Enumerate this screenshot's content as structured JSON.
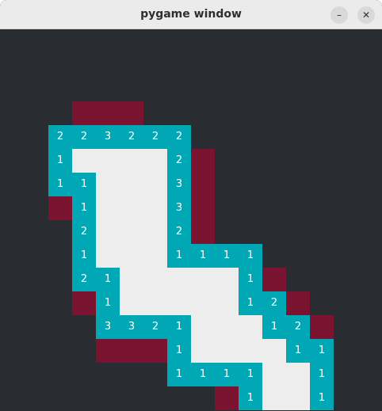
{
  "window": {
    "title": "pygame window",
    "minimize_symbol": "–",
    "close_symbol": "✕"
  },
  "colors": {
    "background": "#292c31",
    "open": "#ededed",
    "number": "#00a8b5",
    "flag": "#7a1330",
    "digit": "#ffffff"
  },
  "cells": [
    {
      "c": 3,
      "r": 3,
      "t": "flag"
    },
    {
      "c": 4,
      "r": 3,
      "t": "flag"
    },
    {
      "c": 5,
      "r": 3,
      "t": "flag"
    },
    {
      "c": 2,
      "r": 4,
      "t": "num",
      "v": "2"
    },
    {
      "c": 3,
      "r": 4,
      "t": "num",
      "v": "2"
    },
    {
      "c": 4,
      "r": 4,
      "t": "num",
      "v": "3"
    },
    {
      "c": 5,
      "r": 4,
      "t": "num",
      "v": "2"
    },
    {
      "c": 6,
      "r": 4,
      "t": "num",
      "v": "2"
    },
    {
      "c": 7,
      "r": 4,
      "t": "num",
      "v": "2"
    },
    {
      "c": 2,
      "r": 5,
      "t": "num",
      "v": "1"
    },
    {
      "c": 3,
      "r": 5,
      "t": "open"
    },
    {
      "c": 4,
      "r": 5,
      "t": "open"
    },
    {
      "c": 5,
      "r": 5,
      "t": "open"
    },
    {
      "c": 6,
      "r": 5,
      "t": "open"
    },
    {
      "c": 7,
      "r": 5,
      "t": "num",
      "v": "2"
    },
    {
      "c": 8,
      "r": 5,
      "t": "flag"
    },
    {
      "c": 2,
      "r": 6,
      "t": "num",
      "v": "1"
    },
    {
      "c": 3,
      "r": 6,
      "t": "num",
      "v": "1"
    },
    {
      "c": 4,
      "r": 6,
      "t": "open"
    },
    {
      "c": 5,
      "r": 6,
      "t": "open"
    },
    {
      "c": 6,
      "r": 6,
      "t": "open"
    },
    {
      "c": 7,
      "r": 6,
      "t": "num",
      "v": "3"
    },
    {
      "c": 8,
      "r": 6,
      "t": "flag"
    },
    {
      "c": 2,
      "r": 7,
      "t": "flag"
    },
    {
      "c": 3,
      "r": 7,
      "t": "num",
      "v": "1"
    },
    {
      "c": 4,
      "r": 7,
      "t": "open"
    },
    {
      "c": 5,
      "r": 7,
      "t": "open"
    },
    {
      "c": 6,
      "r": 7,
      "t": "open"
    },
    {
      "c": 7,
      "r": 7,
      "t": "num",
      "v": "3"
    },
    {
      "c": 8,
      "r": 7,
      "t": "flag"
    },
    {
      "c": 3,
      "r": 8,
      "t": "num",
      "v": "2"
    },
    {
      "c": 4,
      "r": 8,
      "t": "open"
    },
    {
      "c": 5,
      "r": 8,
      "t": "open"
    },
    {
      "c": 6,
      "r": 8,
      "t": "open"
    },
    {
      "c": 7,
      "r": 8,
      "t": "num",
      "v": "2"
    },
    {
      "c": 8,
      "r": 8,
      "t": "flag"
    },
    {
      "c": 3,
      "r": 9,
      "t": "num",
      "v": "1"
    },
    {
      "c": 4,
      "r": 9,
      "t": "open"
    },
    {
      "c": 5,
      "r": 9,
      "t": "open"
    },
    {
      "c": 6,
      "r": 9,
      "t": "open"
    },
    {
      "c": 7,
      "r": 9,
      "t": "num",
      "v": "1"
    },
    {
      "c": 8,
      "r": 9,
      "t": "num",
      "v": "1"
    },
    {
      "c": 9,
      "r": 9,
      "t": "num",
      "v": "1"
    },
    {
      "c": 10,
      "r": 9,
      "t": "num",
      "v": "1"
    },
    {
      "c": 3,
      "r": 10,
      "t": "num",
      "v": "2"
    },
    {
      "c": 4,
      "r": 10,
      "t": "num",
      "v": "1"
    },
    {
      "c": 5,
      "r": 10,
      "t": "open"
    },
    {
      "c": 6,
      "r": 10,
      "t": "open"
    },
    {
      "c": 7,
      "r": 10,
      "t": "open"
    },
    {
      "c": 8,
      "r": 10,
      "t": "open"
    },
    {
      "c": 9,
      "r": 10,
      "t": "open"
    },
    {
      "c": 10,
      "r": 10,
      "t": "num",
      "v": "1"
    },
    {
      "c": 11,
      "r": 10,
      "t": "flag"
    },
    {
      "c": 3,
      "r": 11,
      "t": "flag"
    },
    {
      "c": 4,
      "r": 11,
      "t": "num",
      "v": "1"
    },
    {
      "c": 5,
      "r": 11,
      "t": "open"
    },
    {
      "c": 6,
      "r": 11,
      "t": "open"
    },
    {
      "c": 7,
      "r": 11,
      "t": "open"
    },
    {
      "c": 8,
      "r": 11,
      "t": "open"
    },
    {
      "c": 9,
      "r": 11,
      "t": "open"
    },
    {
      "c": 10,
      "r": 11,
      "t": "num",
      "v": "1"
    },
    {
      "c": 11,
      "r": 11,
      "t": "num",
      "v": "2"
    },
    {
      "c": 12,
      "r": 11,
      "t": "flag"
    },
    {
      "c": 4,
      "r": 12,
      "t": "num",
      "v": "3"
    },
    {
      "c": 5,
      "r": 12,
      "t": "num",
      "v": "3"
    },
    {
      "c": 6,
      "r": 12,
      "t": "num",
      "v": "2"
    },
    {
      "c": 7,
      "r": 12,
      "t": "num",
      "v": "1"
    },
    {
      "c": 8,
      "r": 12,
      "t": "open"
    },
    {
      "c": 9,
      "r": 12,
      "t": "open"
    },
    {
      "c": 10,
      "r": 12,
      "t": "open"
    },
    {
      "c": 11,
      "r": 12,
      "t": "num",
      "v": "1"
    },
    {
      "c": 12,
      "r": 12,
      "t": "num",
      "v": "2"
    },
    {
      "c": 13,
      "r": 12,
      "t": "flag"
    },
    {
      "c": 4,
      "r": 13,
      "t": "flag"
    },
    {
      "c": 5,
      "r": 13,
      "t": "flag"
    },
    {
      "c": 6,
      "r": 13,
      "t": "flag"
    },
    {
      "c": 7,
      "r": 13,
      "t": "num",
      "v": "1"
    },
    {
      "c": 8,
      "r": 13,
      "t": "open"
    },
    {
      "c": 9,
      "r": 13,
      "t": "open"
    },
    {
      "c": 10,
      "r": 13,
      "t": "open"
    },
    {
      "c": 11,
      "r": 13,
      "t": "open"
    },
    {
      "c": 12,
      "r": 13,
      "t": "num",
      "v": "1"
    },
    {
      "c": 13,
      "r": 13,
      "t": "num",
      "v": "1"
    },
    {
      "c": 7,
      "r": 14,
      "t": "num",
      "v": "1"
    },
    {
      "c": 8,
      "r": 14,
      "t": "num",
      "v": "1"
    },
    {
      "c": 9,
      "r": 14,
      "t": "num",
      "v": "1"
    },
    {
      "c": 10,
      "r": 14,
      "t": "num",
      "v": "1"
    },
    {
      "c": 11,
      "r": 14,
      "t": "open"
    },
    {
      "c": 12,
      "r": 14,
      "t": "open"
    },
    {
      "c": 13,
      "r": 14,
      "t": "num",
      "v": "1"
    },
    {
      "c": 9,
      "r": 15,
      "t": "flag"
    },
    {
      "c": 10,
      "r": 15,
      "t": "num",
      "v": "1"
    },
    {
      "c": 11,
      "r": 15,
      "t": "open"
    },
    {
      "c": 12,
      "r": 15,
      "t": "open"
    },
    {
      "c": 13,
      "r": 15,
      "t": "num",
      "v": "1"
    }
  ]
}
